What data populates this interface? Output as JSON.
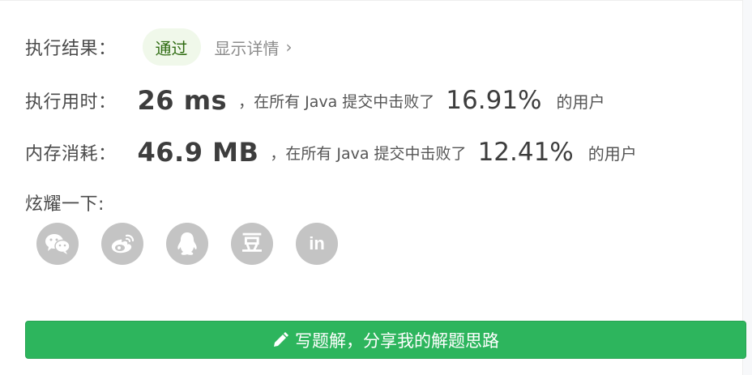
{
  "result": {
    "label": "执行结果：",
    "status": "通过",
    "detail_link": "显示详情",
    "chevron": "›"
  },
  "runtime": {
    "label": "执行用时：",
    "value": "26 ms",
    "mid_text": "，在所有 Java 提交中击败了",
    "percent": "16.91%",
    "tail_text": "的用户"
  },
  "memory": {
    "label": "内存消耗：",
    "value": "46.9 MB",
    "mid_text": "，在所有 Java 提交中击败了",
    "percent": "12.41%",
    "tail_text": "的用户"
  },
  "share": {
    "label": "炫耀一下:",
    "icons": [
      "wechat-icon",
      "weibo-icon",
      "qq-icon",
      "douban-icon",
      "linkedin-icon"
    ],
    "douban_glyph": "豆",
    "linkedin_glyph": "in",
    "icon_bg": "#c4c4c4"
  },
  "write_solution": {
    "label": "写题解，分享我的解题思路",
    "icon": "pencil-icon",
    "color": "#2db55d"
  }
}
